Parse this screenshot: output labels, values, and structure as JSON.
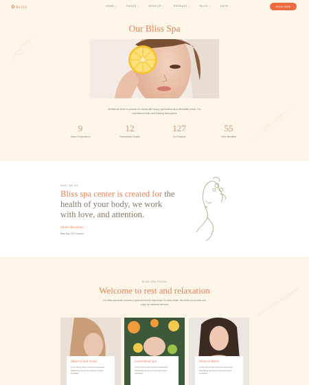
{
  "header": {
    "logo_text": "BLISS",
    "nav": [
      {
        "label": "HOME"
      },
      {
        "label": "PAGES"
      },
      {
        "label": "SERVICE"
      },
      {
        "label": "PRODUCT"
      },
      {
        "label": "BLOG"
      },
      {
        "label": "SHOP"
      }
    ],
    "book_button": "BOOK NOW"
  },
  "hero": {
    "title": "Our Bliss Spa",
    "description": "At Bliss we strive to provide our clients with luxury spa treatments at affordable prices. Our experienced team and relaxing atmosphere",
    "stats": [
      {
        "number": "9",
        "label": "Years Of Experience"
      },
      {
        "number": "12",
        "label": "Professional Centers"
      },
      {
        "number": "127",
        "label": "Our Products"
      },
      {
        "number": "55",
        "label": "Team Members"
      }
    ]
  },
  "about": {
    "kicker": "WHAT WE DO",
    "heading_part1": "Bliss spa center is created for",
    "heading_part2": "the health of your body, we work with love, and attention.",
    "name": "Helen Bowman",
    "role": "Bliss Spa CEO Founder"
  },
  "welcome": {
    "kicker": "BLISS SPA STUDIO",
    "title": "Welcome to rest and relaxation",
    "description": "Our bliss spa studio provides a great stress free experience for every visitor. We invite you to relax and enjoy our wellness services",
    "cards": [
      {
        "title": "Mineral Salt Scrub",
        "text": "Lorem ipsum dolor sit amet consectetur adipisicing elit sed do eiusmod tempor incididunt"
      },
      {
        "title": "Lemonhead Spa",
        "text": "Lorem ipsum dolor sit amet consectetur adipisicing elit sed do eiusmod tempor incididunt"
      },
      {
        "title": "Mineral Baths",
        "text": "Lorem ipsum dolor sit amet consectetur adipisicing elit sed do eiusmod tempor incididunt"
      }
    ]
  },
  "colors": {
    "accent": "#e8835a",
    "button": "#ee6b3f",
    "background": "#fdf6e8"
  }
}
